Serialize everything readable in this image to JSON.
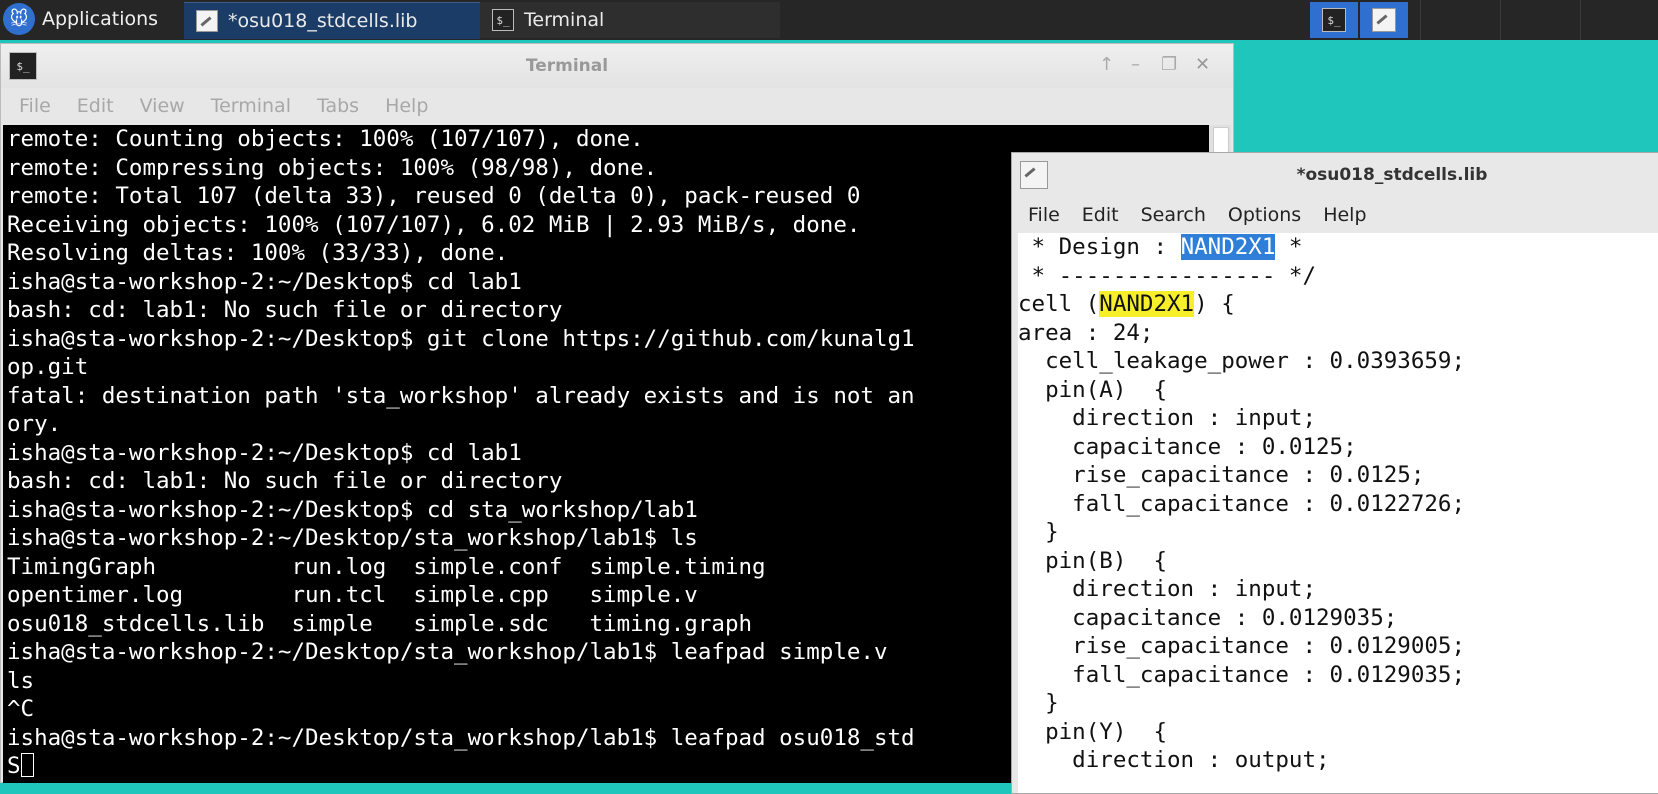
{
  "panel": {
    "apps_label": "Applications",
    "tasks": [
      {
        "label": "*osu018_stdcells.lib",
        "active": true
      },
      {
        "label": "Terminal",
        "active": false
      }
    ],
    "colors": {
      "panel_bg": "#262626",
      "active_task": "#1b3c66",
      "workspace_accent": "#2f6fd0"
    }
  },
  "terminal": {
    "title": "Terminal",
    "menu": [
      "File",
      "Edit",
      "View",
      "Terminal",
      "Tabs",
      "Help"
    ],
    "lines": [
      "remote: Counting objects: 100% (107/107), done.",
      "remote: Compressing objects: 100% (98/98), done.",
      "remote: Total 107 (delta 33), reused 0 (delta 0), pack-reused 0",
      "Receiving objects: 100% (107/107), 6.02 MiB | 2.93 MiB/s, done.",
      "Resolving deltas: 100% (33/33), done.",
      "isha@sta-workshop-2:~/Desktop$ cd lab1",
      "bash: cd: lab1: No such file or directory",
      "isha@sta-workshop-2:~/Desktop$ git clone https://github.com/kunalg1",
      "op.git",
      "fatal: destination path 'sta_workshop' already exists and is not an",
      "ory.",
      "isha@sta-workshop-2:~/Desktop$ cd lab1",
      "bash: cd: lab1: No such file or directory",
      "isha@sta-workshop-2:~/Desktop$ cd sta_workshop/lab1",
      "isha@sta-workshop-2:~/Desktop/sta_workshop/lab1$ ls",
      "TimingGraph          run.log  simple.conf  simple.timing",
      "opentimer.log        run.tcl  simple.cpp   simple.v",
      "osu018_stdcells.lib  simple   simple.sdc   timing.graph",
      "isha@sta-workshop-2:~/Desktop/sta_workshop/lab1$ leafpad simple.v",
      "ls",
      "^C",
      "isha@sta-workshop-2:~/Desktop/sta_workshop/lab1$ leafpad osu018_std"
    ],
    "prompt_last": "S"
  },
  "editor": {
    "title": "*osu018_stdcells.lib",
    "menu": [
      "File",
      "Edit",
      "Search",
      "Options",
      "Help"
    ],
    "line_design": {
      "pre": " * Design : ",
      "sel": "NAND2X1",
      "post": " *"
    },
    "line_sep": " * ---------------- */",
    "line_cell": {
      "pre": "cell (",
      "hl": "NAND2X1",
      "post": ") {"
    },
    "lines": [
      "area : 24;",
      "  cell_leakage_power : 0.0393659;",
      "  pin(A)  {",
      "    direction : input;",
      "    capacitance : 0.0125;",
      "    rise_capacitance : 0.0125;",
      "    fall_capacitance : 0.0122726;",
      "  }",
      "  pin(B)  {",
      "    direction : input;",
      "    capacitance : 0.0129035;",
      "    rise_capacitance : 0.0129005;",
      "    fall_capacitance : 0.0129035;",
      "  }",
      "  pin(Y)  {",
      "    direction : output;"
    ]
  }
}
